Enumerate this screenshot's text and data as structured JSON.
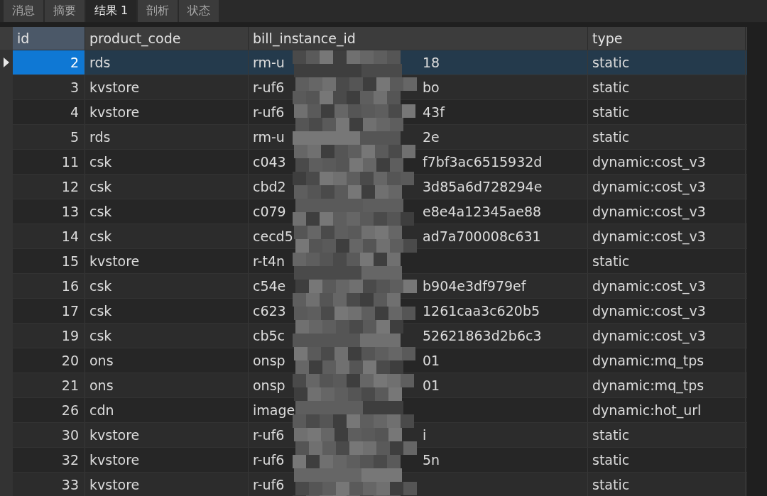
{
  "tabs": [
    {
      "label": "消息",
      "selected": false
    },
    {
      "label": "摘要",
      "selected": false
    },
    {
      "label": "结果 1",
      "selected": true
    },
    {
      "label": "剖析",
      "selected": false
    },
    {
      "label": "状态",
      "selected": false
    }
  ],
  "table": {
    "columns": [
      "id",
      "product_code",
      "bill_instance_id",
      "type"
    ],
    "rows": [
      {
        "id": "2",
        "product_code": "rds",
        "bill_prefix": "rm-u",
        "bill_suffix": "18",
        "type": "static",
        "selected": true
      },
      {
        "id": "3",
        "product_code": "kvstore",
        "bill_prefix": "r-uf6",
        "bill_suffix": "bo",
        "type": "static",
        "selected": false
      },
      {
        "id": "4",
        "product_code": "kvstore",
        "bill_prefix": "r-uf6",
        "bill_suffix": "43f",
        "type": "static",
        "selected": false
      },
      {
        "id": "5",
        "product_code": "rds",
        "bill_prefix": "rm-u",
        "bill_suffix": "2e",
        "type": "static",
        "selected": false
      },
      {
        "id": "11",
        "product_code": "csk",
        "bill_prefix": "c043",
        "bill_suffix": "f7bf3ac6515932d",
        "type": "dynamic:cost_v3",
        "selected": false
      },
      {
        "id": "12",
        "product_code": "csk",
        "bill_prefix": "cbd2",
        "bill_suffix": "3d85a6d728294e",
        "type": "dynamic:cost_v3",
        "selected": false
      },
      {
        "id": "13",
        "product_code": "csk",
        "bill_prefix": "c079",
        "bill_suffix": "e8e4a12345ae88",
        "type": "dynamic:cost_v3",
        "selected": false
      },
      {
        "id": "14",
        "product_code": "csk",
        "bill_prefix": "cecd5",
        "bill_suffix": "ad7a700008c631",
        "type": "dynamic:cost_v3",
        "selected": false
      },
      {
        "id": "15",
        "product_code": "kvstore",
        "bill_prefix": "r-t4n",
        "type": "static",
        "selected": false
      },
      {
        "id": "16",
        "product_code": "csk",
        "bill_prefix": "c54e",
        "bill_suffix": "b904e3df979ef",
        "type": "dynamic:cost_v3",
        "selected": false
      },
      {
        "id": "17",
        "product_code": "csk",
        "bill_prefix": "c623",
        "bill_suffix": "1261caa3c620b5",
        "type": "dynamic:cost_v3",
        "selected": false
      },
      {
        "id": "19",
        "product_code": "csk",
        "bill_prefix": "cb5c",
        "bill_suffix": "52621863d2b6c3",
        "type": "dynamic:cost_v3",
        "selected": false
      },
      {
        "id": "20",
        "product_code": "ons",
        "bill_prefix": "onsp",
        "bill_suffix": "01",
        "type": "dynamic:mq_tps",
        "selected": false
      },
      {
        "id": "21",
        "product_code": "ons",
        "bill_prefix": "onsp",
        "bill_suffix": "01",
        "type": "dynamic:mq_tps",
        "selected": false
      },
      {
        "id": "26",
        "product_code": "cdn",
        "bill_prefix": "image",
        "type": "dynamic:hot_url",
        "selected": false
      },
      {
        "id": "30",
        "product_code": "kvstore",
        "bill_prefix": "r-uf6",
        "bill_suffix": "i",
        "type": "static",
        "selected": false
      },
      {
        "id": "32",
        "product_code": "kvstore",
        "bill_prefix": "r-uf6",
        "bill_suffix": "5n",
        "type": "static",
        "selected": false
      },
      {
        "id": "33",
        "product_code": "kvstore",
        "bill_prefix": "r-uf6",
        "type": "static",
        "selected": false
      }
    ]
  }
}
